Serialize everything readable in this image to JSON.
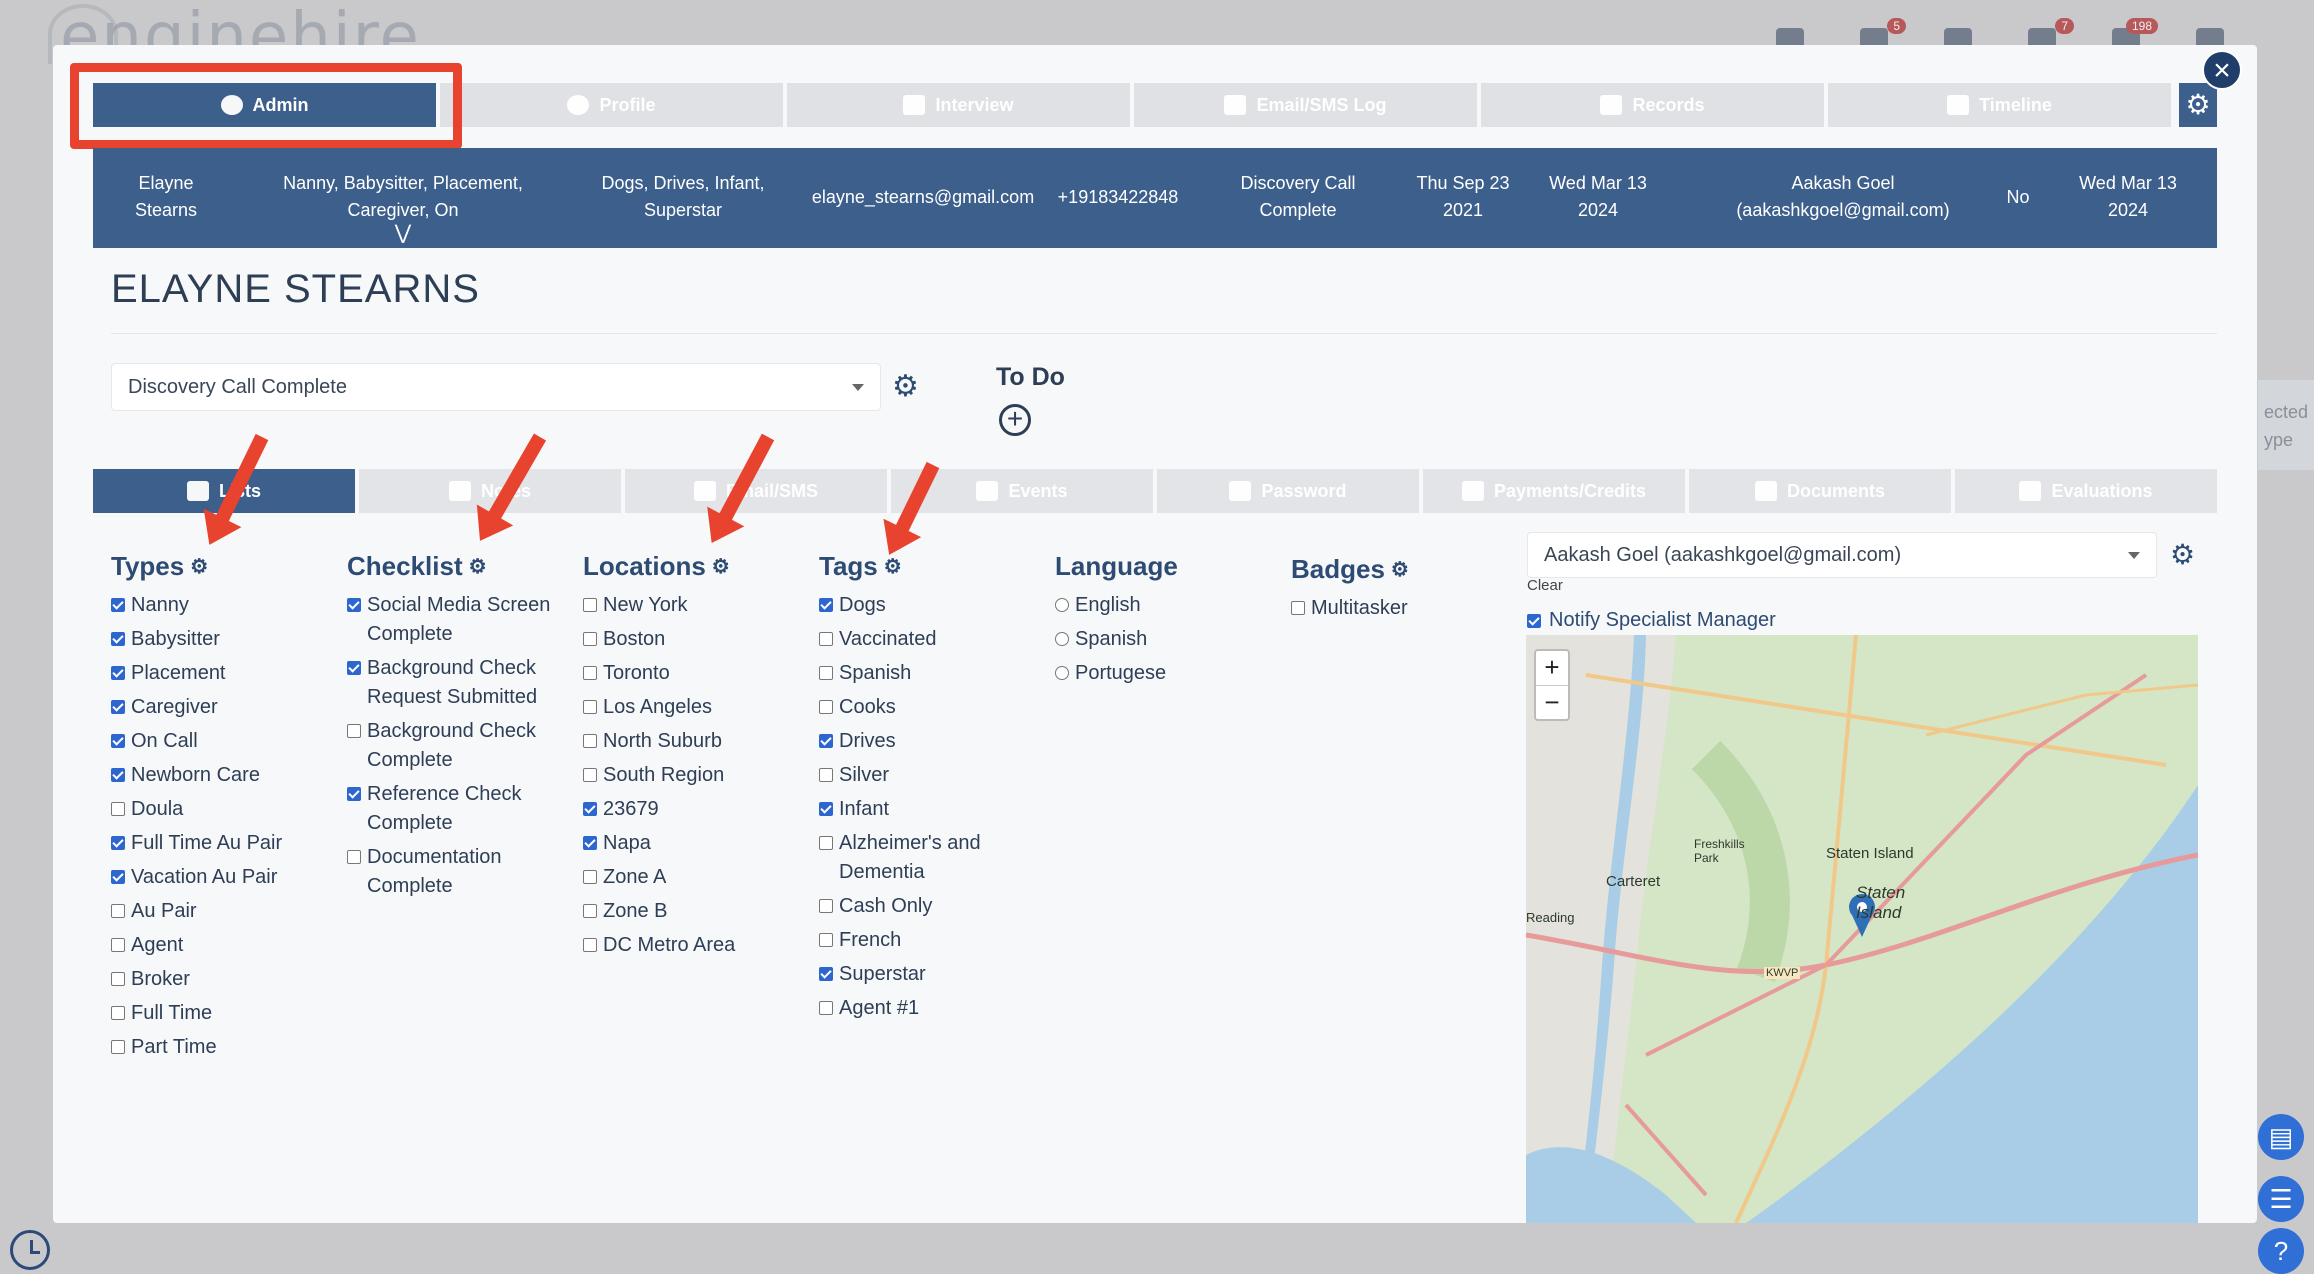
{
  "background": {
    "logo_text": "enginehire",
    "badges": [
      "5",
      "7",
      "198"
    ],
    "side_text": "ected\nype"
  },
  "top_tabs": [
    {
      "label": "Admin",
      "icon": "shield-gear-icon"
    },
    {
      "label": "Profile",
      "icon": "person-icon"
    },
    {
      "label": "Interview",
      "icon": "id-card-icon"
    },
    {
      "label": "Email/SMS Log",
      "icon": "chat-icon"
    },
    {
      "label": "Records",
      "icon": "list-icon"
    },
    {
      "label": "Timeline",
      "icon": "timeline-icon"
    }
  ],
  "summary": {
    "name": "Elayne Stearns",
    "types": "Nanny, Babysitter, Placement, Caregiver, On",
    "tags": "Dogs, Drives, Infant, Superstar",
    "email": "elayne_stearns@gmail.com",
    "phone": "+19183422848",
    "stage": "Discovery Call Complete",
    "date1": "Thu Sep 23 2021",
    "date2": "Wed Mar 13 2024",
    "owner": "Aakash Goel (aakashkgoel@gmail.com)",
    "flag": "No",
    "date3": "Wed Mar 13 2024"
  },
  "title": "ELAYNE STEARNS",
  "stage_select": "Discovery Call Complete",
  "todo": {
    "label": "To Do"
  },
  "sub_tabs": [
    {
      "label": "Lists"
    },
    {
      "label": "Notes"
    },
    {
      "label": "Email/SMS"
    },
    {
      "label": "Events"
    },
    {
      "label": "Password"
    },
    {
      "label": "Payments/Credits"
    },
    {
      "label": "Documents"
    },
    {
      "label": "Evaluations"
    }
  ],
  "types": {
    "title": "Types",
    "items": [
      {
        "label": "Nanny",
        "checked": true
      },
      {
        "label": "Babysitter",
        "checked": true
      },
      {
        "label": "Placement",
        "checked": true
      },
      {
        "label": "Caregiver",
        "checked": true
      },
      {
        "label": "On Call",
        "checked": true
      },
      {
        "label": "Newborn Care",
        "checked": true
      },
      {
        "label": "Doula",
        "checked": false
      },
      {
        "label": "Full Time Au Pair",
        "checked": true
      },
      {
        "label": "Vacation Au Pair",
        "checked": true
      },
      {
        "label": "Au Pair",
        "checked": false
      },
      {
        "label": "Agent",
        "checked": false
      },
      {
        "label": "Broker",
        "checked": false
      },
      {
        "label": "Full Time",
        "checked": false
      },
      {
        "label": "Part Time",
        "checked": false
      }
    ]
  },
  "checklist": {
    "title": "Checklist",
    "items": [
      {
        "label": "Social Media Screen Complete",
        "checked": true
      },
      {
        "label": "Background Check Request Submitted",
        "checked": true
      },
      {
        "label": "Background Check Complete",
        "checked": false
      },
      {
        "label": "Reference Check Complete",
        "checked": true
      },
      {
        "label": "Documentation Complete",
        "checked": false
      }
    ]
  },
  "locations": {
    "title": "Locations",
    "items": [
      {
        "label": "New York",
        "checked": false
      },
      {
        "label": "Boston",
        "checked": false
      },
      {
        "label": "Toronto",
        "checked": false
      },
      {
        "label": "Los Angeles",
        "checked": false
      },
      {
        "label": "North Suburb",
        "checked": false
      },
      {
        "label": "South Region",
        "checked": false
      },
      {
        "label": "23679",
        "checked": true
      },
      {
        "label": "Napa",
        "checked": true
      },
      {
        "label": "Zone A",
        "checked": false
      },
      {
        "label": "Zone B",
        "checked": false
      },
      {
        "label": "DC Metro Area",
        "checked": false
      }
    ]
  },
  "tags": {
    "title": "Tags",
    "items": [
      {
        "label": "Dogs",
        "checked": true
      },
      {
        "label": "Vaccinated",
        "checked": false
      },
      {
        "label": "Spanish",
        "checked": false
      },
      {
        "label": "Cooks",
        "checked": false
      },
      {
        "label": "Drives",
        "checked": true
      },
      {
        "label": "Silver",
        "checked": false
      },
      {
        "label": "Infant",
        "checked": true
      },
      {
        "label": "Alzheimer's and Dementia",
        "checked": false
      },
      {
        "label": "Cash Only",
        "checked": false
      },
      {
        "label": "French",
        "checked": false
      },
      {
        "label": "Superstar",
        "checked": true
      },
      {
        "label": "Agent #1",
        "checked": false
      }
    ]
  },
  "language": {
    "title": "Language",
    "items": [
      {
        "label": "English"
      },
      {
        "label": "Spanish"
      },
      {
        "label": "Portugese"
      }
    ]
  },
  "badges": {
    "title": "Badges",
    "items": [
      {
        "label": "Multitasker",
        "checked": false
      }
    ]
  },
  "manager_select": "Aakash Goel (aakashkgoel@gmail.com)",
  "clear_label": "Clear",
  "notify_label": "Notify Specialist Manager",
  "notify_checked": true,
  "map": {
    "labels": [
      "Carteret",
      "Staten Island",
      "Staten Island",
      "Freshkills Park",
      "KWVP",
      "Reading"
    ]
  },
  "colors": {
    "accent": "#3d5f8c",
    "annotation": "#e8432e",
    "checkbox": "#2e66cf"
  }
}
